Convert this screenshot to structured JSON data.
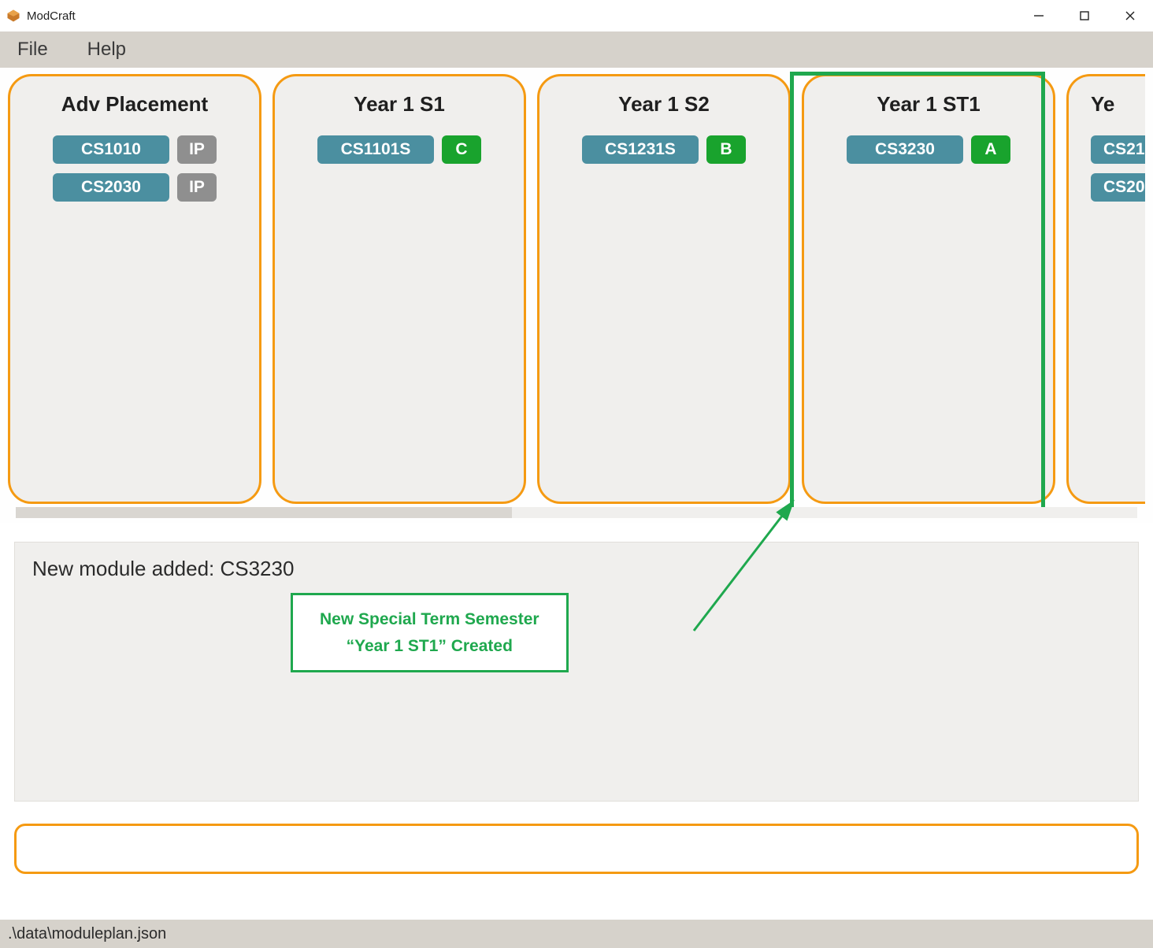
{
  "app": {
    "title": "ModCraft"
  },
  "menu": {
    "file": "File",
    "help": "Help"
  },
  "semesters": [
    {
      "title": "Adv Placement",
      "modules": [
        {
          "code": "CS1010",
          "grade": "IP",
          "gradeClass": "grade-ip"
        },
        {
          "code": "CS2030",
          "grade": "IP",
          "gradeClass": "grade-ip"
        }
      ]
    },
    {
      "title": "Year 1 S1",
      "modules": [
        {
          "code": "CS1101S",
          "grade": "C",
          "gradeClass": "grade-green"
        }
      ]
    },
    {
      "title": "Year 1 S2",
      "modules": [
        {
          "code": "CS1231S",
          "grade": "B",
          "gradeClass": "grade-green"
        }
      ]
    },
    {
      "title": "Year 1 ST1",
      "modules": [
        {
          "code": "CS3230",
          "grade": "A",
          "gradeClass": "grade-green"
        }
      ]
    }
  ],
  "partial": {
    "title": "Ye",
    "modules": [
      {
        "code": "CS21"
      },
      {
        "code": "CS20"
      }
    ]
  },
  "status": {
    "message": "New module added: CS3230"
  },
  "callout": {
    "line1": "New Special Term  Semester",
    "line2": "“Year 1 ST1” Created"
  },
  "command": {
    "value": "",
    "placeholder": ""
  },
  "footer": {
    "path": ".\\data\\moduleplan.json"
  },
  "colors": {
    "accent": "#f59a12",
    "highlight": "#1fa84e",
    "chip": "#4b8fa0"
  }
}
